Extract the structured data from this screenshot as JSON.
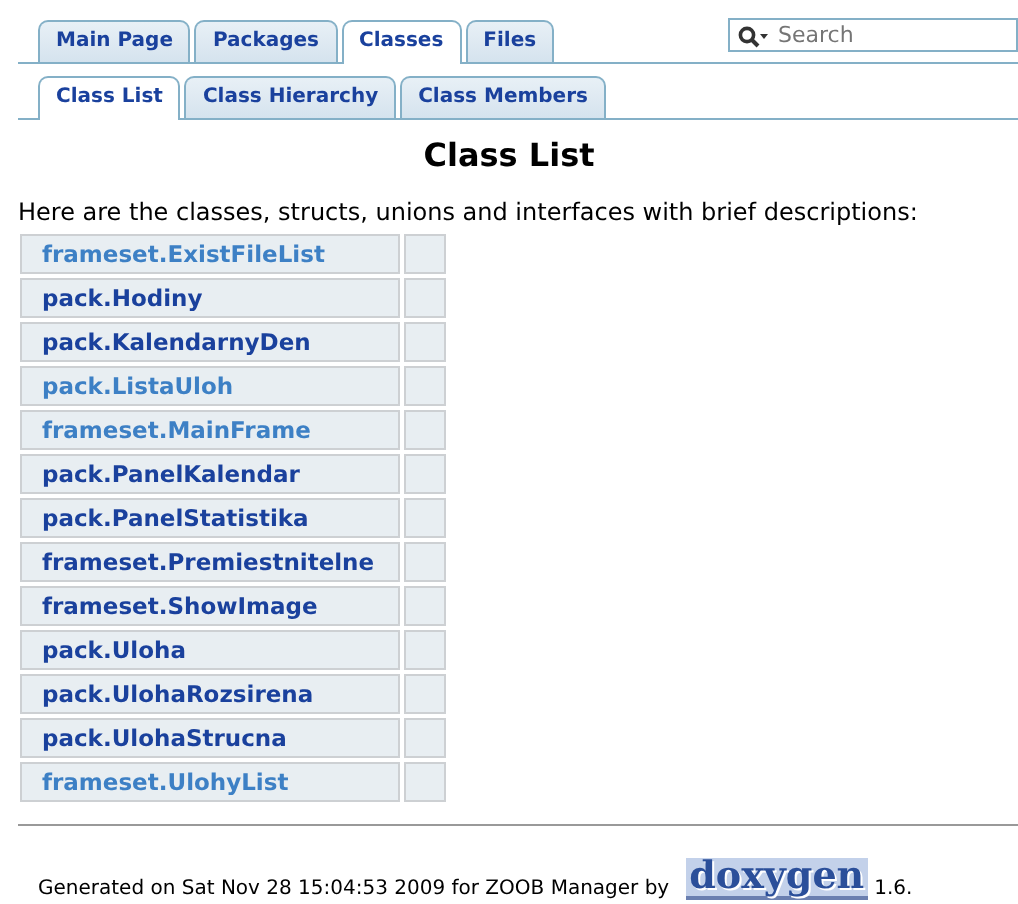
{
  "tabs": [
    {
      "label": "Main Page",
      "selected": false
    },
    {
      "label": "Packages",
      "selected": false
    },
    {
      "label": "Classes",
      "selected": true
    },
    {
      "label": "Files",
      "selected": false
    }
  ],
  "search": {
    "placeholder": "Search"
  },
  "subtabs": [
    {
      "label": "Class List",
      "selected": true
    },
    {
      "label": "Class Hierarchy",
      "selected": false
    },
    {
      "label": "Class Members",
      "selected": false
    }
  ],
  "title": "Class List",
  "intro": "Here are the classes, structs, unions and interfaces with brief descriptions:",
  "classes": [
    {
      "name": "frameset.ExistFileList",
      "visited": true
    },
    {
      "name": "pack.Hodiny",
      "visited": false
    },
    {
      "name": "pack.KalendarnyDen",
      "visited": false
    },
    {
      "name": "pack.ListaUloh",
      "visited": true
    },
    {
      "name": "frameset.MainFrame",
      "visited": true
    },
    {
      "name": "pack.PanelKalendar",
      "visited": false
    },
    {
      "name": "pack.PanelStatistika",
      "visited": false
    },
    {
      "name": "frameset.Premiestnitelne",
      "visited": false
    },
    {
      "name": "frameset.ShowImage",
      "visited": false
    },
    {
      "name": "pack.Uloha",
      "visited": false
    },
    {
      "name": "pack.UlohaRozsirena",
      "visited": false
    },
    {
      "name": "pack.UlohaStrucna",
      "visited": false
    },
    {
      "name": "frameset.UlohyList",
      "visited": true
    }
  ],
  "footer": {
    "text": "Generated on Sat Nov 28 15:04:53 2009 for ZOOB Manager by",
    "logo": "doxygen",
    "version": "1.6."
  }
}
